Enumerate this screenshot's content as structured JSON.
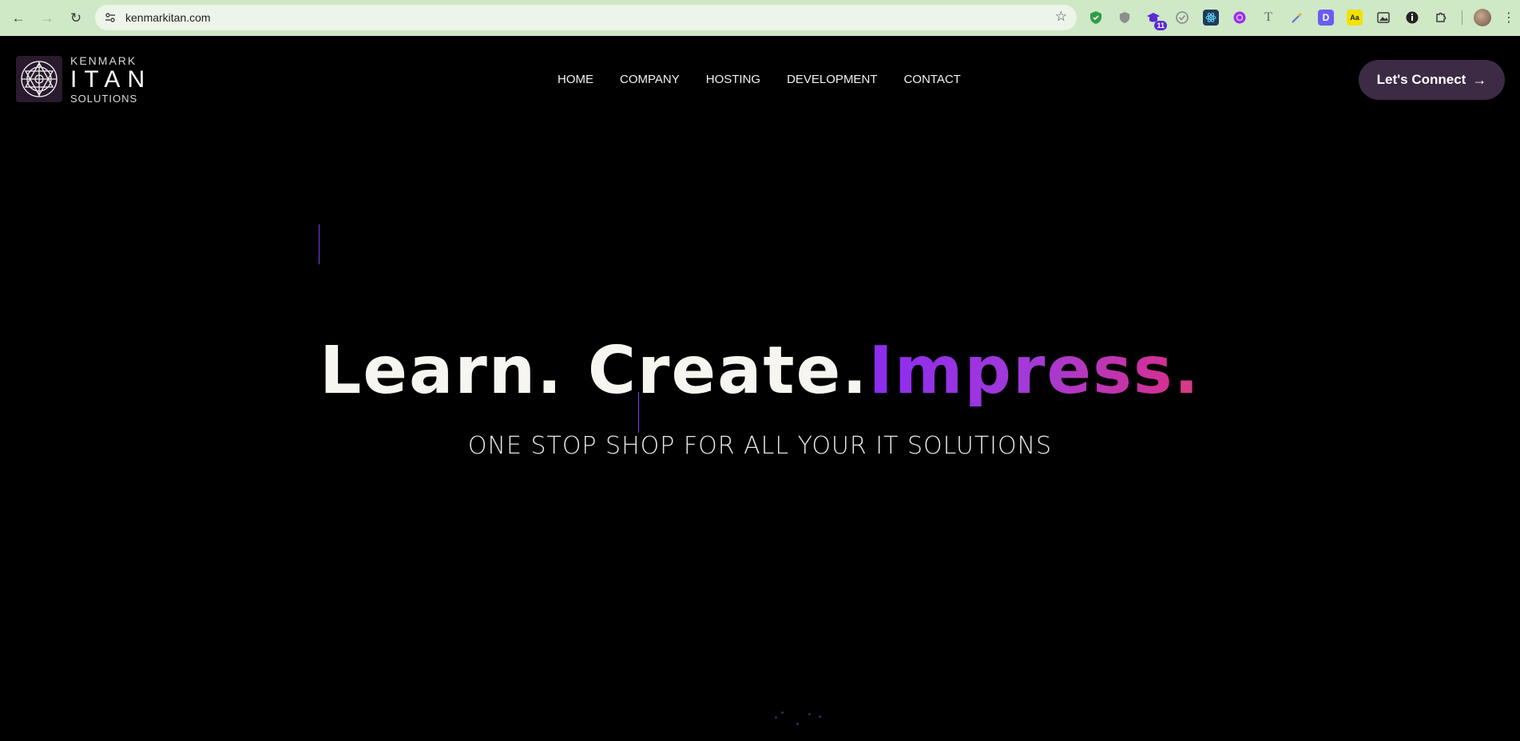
{
  "browser": {
    "url": "kenmarkitan.com",
    "back_icon": "arrow-left",
    "forward_icon": "arrow-right",
    "reload_icon": "reload",
    "extensions": [
      {
        "name": "shield-check-extension",
        "color": "#2e9e44"
      },
      {
        "name": "shield-extension",
        "color": "#8d8d8d"
      },
      {
        "name": "graduation-cap-extension",
        "color": "#5b2bd6",
        "badge": "11"
      },
      {
        "name": "check-circle-extension",
        "color": "#7d7d7d"
      },
      {
        "name": "react-extension",
        "color": "#1f3a5a"
      },
      {
        "name": "purple-circle-extension",
        "color": "#9b2cf0"
      },
      {
        "name": "text-t-extension",
        "color": "#666666",
        "glyph": "T"
      },
      {
        "name": "eyedropper-extension",
        "color": "#6b6bd6"
      },
      {
        "name": "d-extension",
        "color": "#6a5cf0",
        "glyph": "D"
      },
      {
        "name": "dictionary-extension",
        "color": "#f2e200",
        "glyph": "Aa"
      },
      {
        "name": "image-extension",
        "color": "#3b3b3b"
      },
      {
        "name": "info-extension",
        "color": "#222222"
      },
      {
        "name": "puzzle-extension",
        "color": "#3b3b3b"
      }
    ]
  },
  "header": {
    "logo": {
      "top": "KENMARK",
      "middle": "ITAN",
      "bottom": "SOLUTIONS"
    },
    "nav": [
      "HOME",
      "COMPANY",
      "HOSTING",
      "DEVELOPMENT",
      "CONTACT"
    ],
    "cta_label": "Let's Connect",
    "cta_color": "#3d2a45"
  },
  "hero": {
    "title_part1": "Learn. Create.",
    "title_part2": "Impress",
    "title_part3": ".",
    "subtitle": "ONE STOP SHOP FOR ALL YOUR IT SOLUTIONS",
    "accent_start": "#8b2cf0",
    "accent_end": "#d6308f"
  }
}
